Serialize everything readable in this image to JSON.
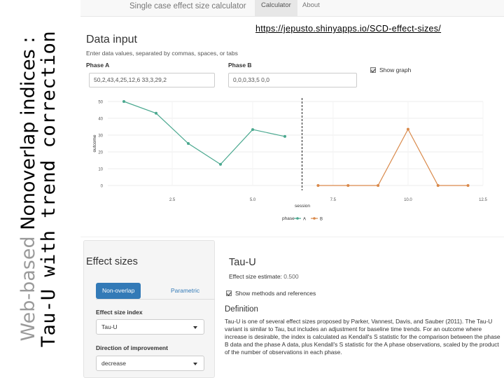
{
  "slide": {
    "title_light": "Web-based",
    "title_dark": " Nonoverlap indices :",
    "title_line2": "Tau-U with trend correction",
    "url": "https://jepusto.shinyapps.io/SCD-effect-sizes/"
  },
  "navbar": {
    "brand": "Single case effect size calculator",
    "tabs": [
      "Calculator",
      "About"
    ]
  },
  "data_input": {
    "heading": "Data input",
    "help": "Enter data values, separated by commas, spaces, or tabs",
    "phase_a_label": "Phase A",
    "phase_a_value": "50,2,43,4,25,12,6 33,3,29,2",
    "phase_b_label": "Phase B",
    "phase_b_value": "0,0,0,33,5 0,0",
    "show_graph_label": "Show graph"
  },
  "chart_data": {
    "type": "line",
    "xlabel": "session",
    "ylabel": "outcome",
    "ylim": [
      0,
      50
    ],
    "y_ticks": [
      "0",
      "10",
      "20",
      "30",
      "40",
      "50"
    ],
    "left_x_ticks": [
      "2.5",
      "5.0"
    ],
    "right_x_ticks": [
      "7.5",
      "10.0",
      "12.5"
    ],
    "legend_title": "phase",
    "legend_entries": [
      "A",
      "B"
    ],
    "colors": {
      "A": "#4aa88f",
      "B": "#d9894a"
    },
    "series": [
      {
        "name": "A",
        "x": [
          1,
          2,
          3,
          4,
          5,
          6
        ],
        "values": [
          50,
          43,
          25,
          12.6,
          33.3,
          29.2
        ]
      },
      {
        "name": "B",
        "x": [
          7,
          8,
          9,
          10,
          11,
          12
        ],
        "values": [
          0,
          0,
          0,
          33.5,
          0,
          0
        ]
      }
    ],
    "phase_change_after": 6.5
  },
  "effect_sizes": {
    "heading": "Effect sizes",
    "tab_active": "Non-overlap",
    "tab_inactive": "Parametric",
    "index_label": "Effect size index",
    "index_value": "Tau-U",
    "direction_label": "Direction of improvement",
    "direction_value": "decrease"
  },
  "result": {
    "heading": "Tau-U",
    "estimate_label": "Effect size estimate:",
    "estimate_value": "0.500",
    "show_methods_label": "Show methods and references",
    "definition_heading": "Definition",
    "definition_text": "Tau-U is one of several effect sizes proposed by Parker, Vannest, Davis, and Sauber (2011). The Tau-U variant is similar to Tau, but includes an adjustment for baseline time trends. For an outcome where increase is desirable, the index is calculated as Kendall's S statistic for the comparison between the phase B data and the phase A data, plus Kendall's S statistic for the A phase observations, scaled by the product of the number of observations in each phase."
  }
}
